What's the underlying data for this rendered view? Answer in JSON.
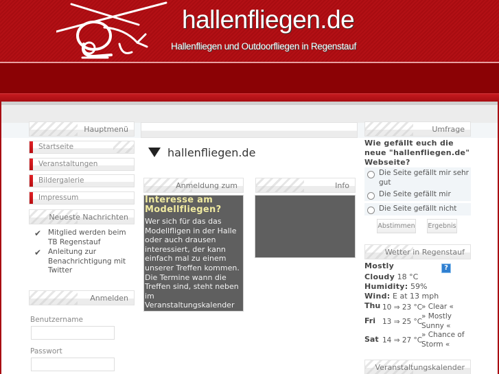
{
  "header": {
    "site_title": "hallenfliegen.de",
    "subtitle": "Hallenfliegen und  Outdoorfliegen in Regenstauf",
    "logo_icon": "helicopter-icon"
  },
  "colors": {
    "brand_red": "#a80c11",
    "band_dark_red": "#8b0205",
    "box_dark": "#5f5f5f",
    "box_title_yellow": "#f0eaa0"
  },
  "left": {
    "main_menu": {
      "title": "Hauptmenü",
      "items": [
        {
          "label": "Startseite",
          "active": true
        },
        {
          "label": "Veranstaltungen",
          "active": false
        },
        {
          "label": "Bildergalerie",
          "active": false
        },
        {
          "label": "Impressum",
          "active": false
        }
      ]
    },
    "news": {
      "title": "Neueste Nachrichten",
      "items": [
        {
          "label": "Mitglied werden beim TB Regenstauf",
          "icon": "check-icon"
        },
        {
          "label": "Anleitung zur Benachrichtigung mit Twitter",
          "icon": "check-icon"
        }
      ]
    },
    "login": {
      "title": "Anmelden",
      "username_label": "Benutzername",
      "username_value": "",
      "password_label": "Passwort",
      "password_value": ""
    }
  },
  "center": {
    "heading": "hallenfliegen.de",
    "registration": {
      "title": "Anmeldung zum",
      "box_title": "Interesse am Modellfliegen?",
      "box_text": "Wer sich für das das Modellfligen in der Halle oder auch drausen interessiert, der kann einfach mal zu einem unserer Treffen kommen. Die Termine wann die Treffen sind, steht neben im Veranstaltungskalender"
    },
    "info": {
      "title": "Info"
    }
  },
  "right": {
    "poll": {
      "title": "Umfrage",
      "question": "Wie gefällt euch die neue \"hallenfliegen.de\" Webseite?",
      "options": [
        "Die Seite gefällt mir sehr gut",
        "Die Seite gefällt mir",
        "Die Seite gefällt nicht"
      ],
      "vote_label": "Abstimmen",
      "result_label": "Ergebnis"
    },
    "weather": {
      "title": "Wetter in Regenstauf",
      "condition_1": "Mostly",
      "condition_2": "Cloudy",
      "temp": "18 °C",
      "humidity_label": "Humidity:",
      "humidity": "59%",
      "wind_label": "Wind:",
      "wind": "E at 13 mph",
      "help_icon": "?",
      "forecast": [
        {
          "day": "Thu",
          "temp": "10 ⇒ 23 °C",
          "cond": "» Clear «"
        },
        {
          "day": "Fri",
          "temp": "13 ⇒ 25 °C",
          "cond": "» Mostly Sunny «"
        },
        {
          "day": "Sat",
          "temp": "14 ⇒ 27 °C",
          "cond": "» Chance of Storm «"
        }
      ]
    },
    "calendar": {
      "title": "Veranstaltungskalender"
    }
  }
}
